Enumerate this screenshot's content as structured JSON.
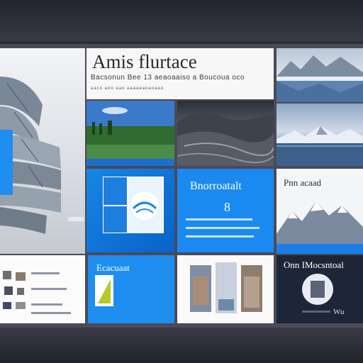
{
  "window": {
    "accent": "#1a8af0",
    "dark_tile": "#1d2636"
  },
  "tiles": {
    "hero": {
      "title": "Amis flurtace",
      "subtitle": "Bacsonun Bee 13 aeaoaaiso a Boucoua oco",
      "meta": "aaco aoo aao aaaaeaoaoaao"
    },
    "building": {
      "icon": "windows-logo-icon"
    },
    "landscape_top": {
      "image": "mountain-lake-photo"
    },
    "forest": {
      "image": "forest-lake-photo"
    },
    "rocks": {
      "image": "rocky-coast-photo"
    },
    "lake": {
      "image": "snowy-mountain-lake-photo"
    },
    "windows_tile": {
      "icon": "windows-window-icon"
    },
    "blue_text_tile": {
      "title": "Bnorroatalt",
      "number": "8"
    },
    "mountain_tile": {
      "title": "Pnn acaad"
    },
    "contacts_tile": {
      "icon": "contacts-list-icon"
    },
    "tablet_tile": {
      "title": "Ecacuaat",
      "icon": "tablet-icon"
    },
    "gallery_tile": {
      "icon": "photo-gallery-icon"
    },
    "dark_tile": {
      "title": "Onn IMocsntoal",
      "footer": "Wu",
      "icon": "user-avatar-icon"
    }
  }
}
